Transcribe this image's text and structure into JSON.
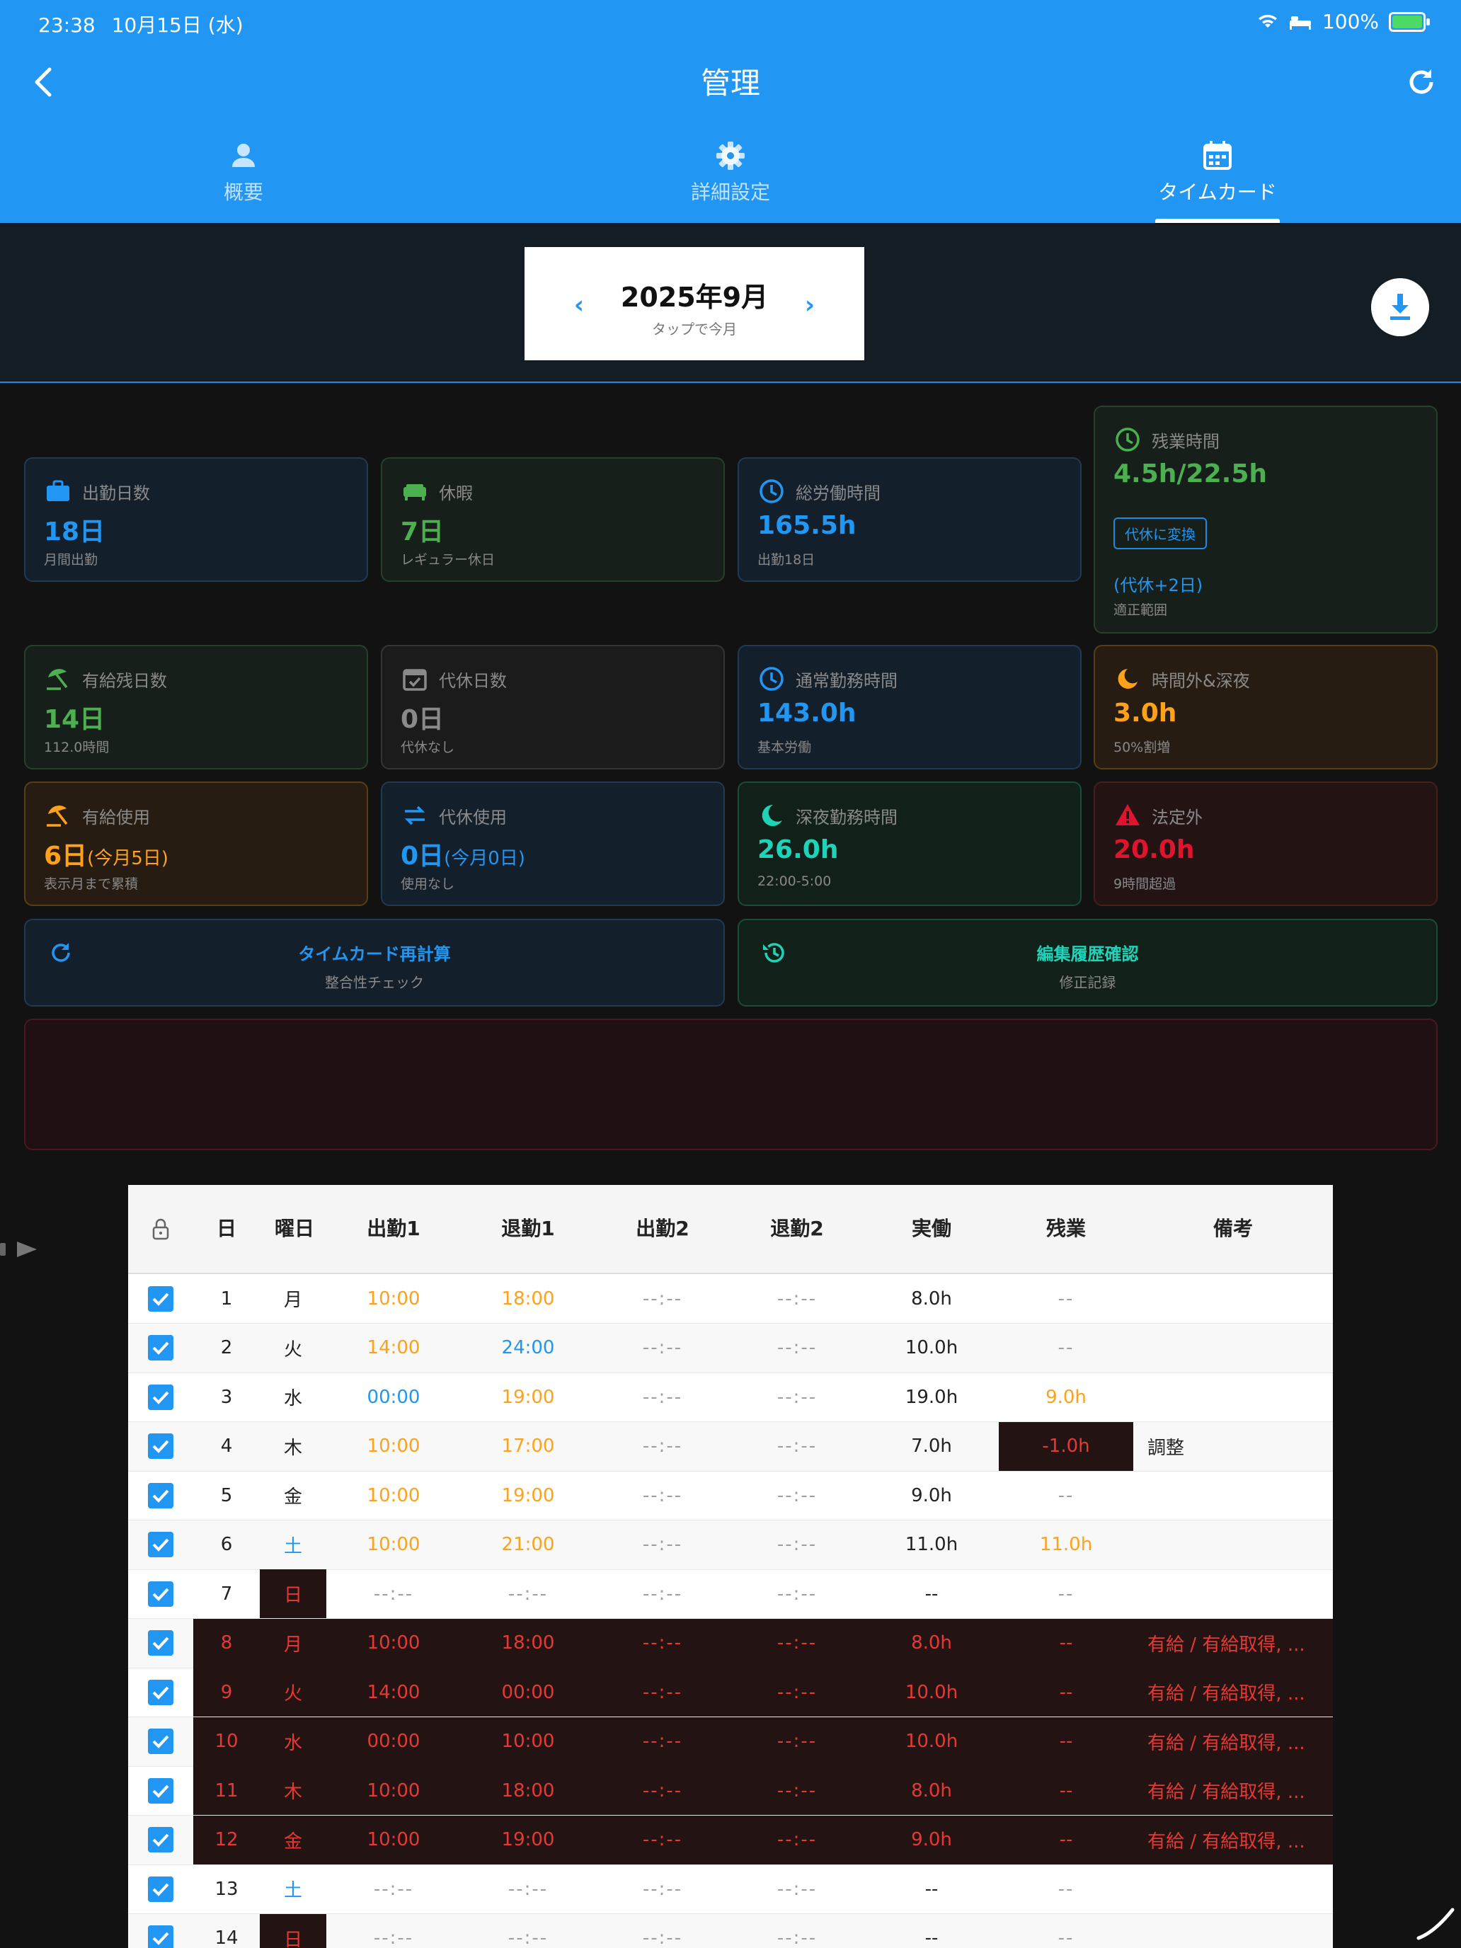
{
  "status": {
    "time": "23:38",
    "date": "10月15日 (水)",
    "battery": "100%"
  },
  "header": {
    "title": "管理"
  },
  "tabs": [
    {
      "label": "概要"
    },
    {
      "label": "詳細設定"
    },
    {
      "label": "タイムカード"
    }
  ],
  "month": {
    "label": "2025年9月",
    "sub": "タップで今月"
  },
  "cards": {
    "attendance": {
      "title": "出勤日数",
      "value": "18日",
      "sub": "月間出勤"
    },
    "holiday": {
      "title": "休暇",
      "value": "7日",
      "sub": "レギュラー休日"
    },
    "total": {
      "title": "総労働時間",
      "value": "165.5h",
      "sub": "出勤18日"
    },
    "overtime": {
      "title": "残業時間",
      "value": "4.5h/22.5h",
      "button": "代休に変換",
      "extra": "(代休+2日)",
      "sub": "適正範囲"
    },
    "paid_remaining": {
      "title": "有給残日数",
      "value": "14日",
      "sub": "112.0時間"
    },
    "comp_days": {
      "title": "代休日数",
      "value": "0日",
      "sub": "代休なし"
    },
    "regular": {
      "title": "通常勤務時間",
      "value": "143.0h",
      "sub": "基本労働"
    },
    "offhours": {
      "title": "時間外&深夜",
      "value": "3.0h",
      "sub": "50%割増"
    },
    "paid_used": {
      "title": "有給使用",
      "value": "6日",
      "value_small": "(今月5日)",
      "sub": "表示月まで累積"
    },
    "comp_used": {
      "title": "代休使用",
      "value": "0日",
      "value_small": "(今月0日)",
      "sub": "使用なし"
    },
    "night": {
      "title": "深夜勤務時間",
      "value": "26.0h",
      "sub": "22:00-5:00"
    },
    "illegal": {
      "title": "法定外",
      "value": "20.0h",
      "sub": "9時間超過"
    }
  },
  "actions": {
    "recalc": {
      "label": "タイムカード再計算",
      "sub": "整合性チェック"
    },
    "history": {
      "label": "編集履歴確認",
      "sub": "修正記録"
    }
  },
  "colors": {
    "accent": "#2196F3",
    "orange": "#ffa21a",
    "red": "#e53935",
    "green": "#4caf50",
    "teal": "#1ed4b8"
  },
  "table": {
    "headers": [
      "日",
      "曜日",
      "出勤1",
      "退勤1",
      "出勤2",
      "退勤2",
      "実働",
      "残業",
      "備考"
    ],
    "rows": [
      {
        "day": "1",
        "dow": "月",
        "in1": "10:00",
        "out1": "18:00",
        "in2": "--:--",
        "out2": "--:--",
        "work": "8.0h",
        "ot": "--",
        "note": "",
        "dowc": "blk",
        "inc": "org",
        "outc": "org",
        "otc": "dim",
        "rowc": ""
      },
      {
        "day": "2",
        "dow": "火",
        "in1": "14:00",
        "out1": "24:00",
        "in2": "--:--",
        "out2": "--:--",
        "work": "10.0h",
        "ot": "--",
        "note": "",
        "dowc": "blk",
        "inc": "org",
        "outc": "blu",
        "otc": "dim",
        "rowc": ""
      },
      {
        "day": "3",
        "dow": "水",
        "in1": "00:00",
        "out1": "19:00",
        "in2": "--:--",
        "out2": "--:--",
        "work": "19.0h",
        "ot": "9.0h",
        "note": "",
        "dowc": "blk",
        "inc": "blu",
        "outc": "org",
        "otc": "org",
        "rowc": ""
      },
      {
        "day": "4",
        "dow": "木",
        "in1": "10:00",
        "out1": "17:00",
        "in2": "--:--",
        "out2": "--:--",
        "work": "7.0h",
        "ot": "-1.0h",
        "note": "調整",
        "dowc": "blk",
        "inc": "org",
        "outc": "org",
        "otc": "red",
        "rowc": ""
      },
      {
        "day": "5",
        "dow": "金",
        "in1": "10:00",
        "out1": "19:00",
        "in2": "--:--",
        "out2": "--:--",
        "work": "9.0h",
        "ot": "--",
        "note": "",
        "dowc": "blk",
        "inc": "org",
        "outc": "org",
        "otc": "dim",
        "rowc": ""
      },
      {
        "day": "6",
        "dow": "土",
        "in1": "10:00",
        "out1": "21:00",
        "in2": "--:--",
        "out2": "--:--",
        "work": "11.0h",
        "ot": "11.0h",
        "note": "",
        "dowc": "blu",
        "inc": "org",
        "outc": "org",
        "otc": "org",
        "rowc": ""
      },
      {
        "day": "7",
        "dow": "日",
        "in1": "--:--",
        "out1": "--:--",
        "in2": "--:--",
        "out2": "--:--",
        "work": "--",
        "ot": "--",
        "note": "",
        "dowc": "red",
        "inc": "dim",
        "outc": "dim",
        "otc": "dim",
        "rowc": ""
      },
      {
        "day": "8",
        "dow": "月",
        "in1": "10:00",
        "out1": "18:00",
        "in2": "--:--",
        "out2": "--:--",
        "work": "8.0h",
        "ot": "--",
        "note": "有給 / 有給取得, ...",
        "dowc": "red",
        "inc": "red",
        "outc": "red",
        "otc": "red",
        "rowc": "red"
      },
      {
        "day": "9",
        "dow": "火",
        "in1": "14:00",
        "out1": "00:00",
        "in2": "--:--",
        "out2": "--:--",
        "work": "10.0h",
        "ot": "--",
        "note": "有給 / 有給取得, ...",
        "dowc": "red",
        "inc": "red",
        "outc": "red",
        "otc": "red",
        "rowc": "red"
      },
      {
        "day": "10",
        "dow": "水",
        "in1": "00:00",
        "out1": "10:00",
        "in2": "--:--",
        "out2": "--:--",
        "work": "10.0h",
        "ot": "--",
        "note": "有給 / 有給取得, ...",
        "dowc": "red",
        "inc": "red",
        "outc": "red",
        "otc": "red",
        "rowc": "red"
      },
      {
        "day": "11",
        "dow": "木",
        "in1": "10:00",
        "out1": "18:00",
        "in2": "--:--",
        "out2": "--:--",
        "work": "8.0h",
        "ot": "--",
        "note": "有給 / 有給取得, ...",
        "dowc": "red",
        "inc": "red",
        "outc": "red",
        "otc": "red",
        "rowc": "red"
      },
      {
        "day": "12",
        "dow": "金",
        "in1": "10:00",
        "out1": "19:00",
        "in2": "--:--",
        "out2": "--:--",
        "work": "9.0h",
        "ot": "--",
        "note": "有給 / 有給取得, ...",
        "dowc": "red",
        "inc": "red",
        "outc": "red",
        "otc": "red",
        "rowc": "red"
      },
      {
        "day": "13",
        "dow": "土",
        "in1": "--:--",
        "out1": "--:--",
        "in2": "--:--",
        "out2": "--:--",
        "work": "--",
        "ot": "--",
        "note": "",
        "dowc": "blu",
        "inc": "dim",
        "outc": "dim",
        "otc": "dim",
        "rowc": ""
      },
      {
        "day": "14",
        "dow": "日",
        "in1": "--:--",
        "out1": "--:--",
        "in2": "--:--",
        "out2": "--:--",
        "work": "--",
        "ot": "--",
        "note": "",
        "dowc": "red",
        "inc": "dim",
        "outc": "dim",
        "otc": "dim",
        "rowc": ""
      }
    ]
  }
}
